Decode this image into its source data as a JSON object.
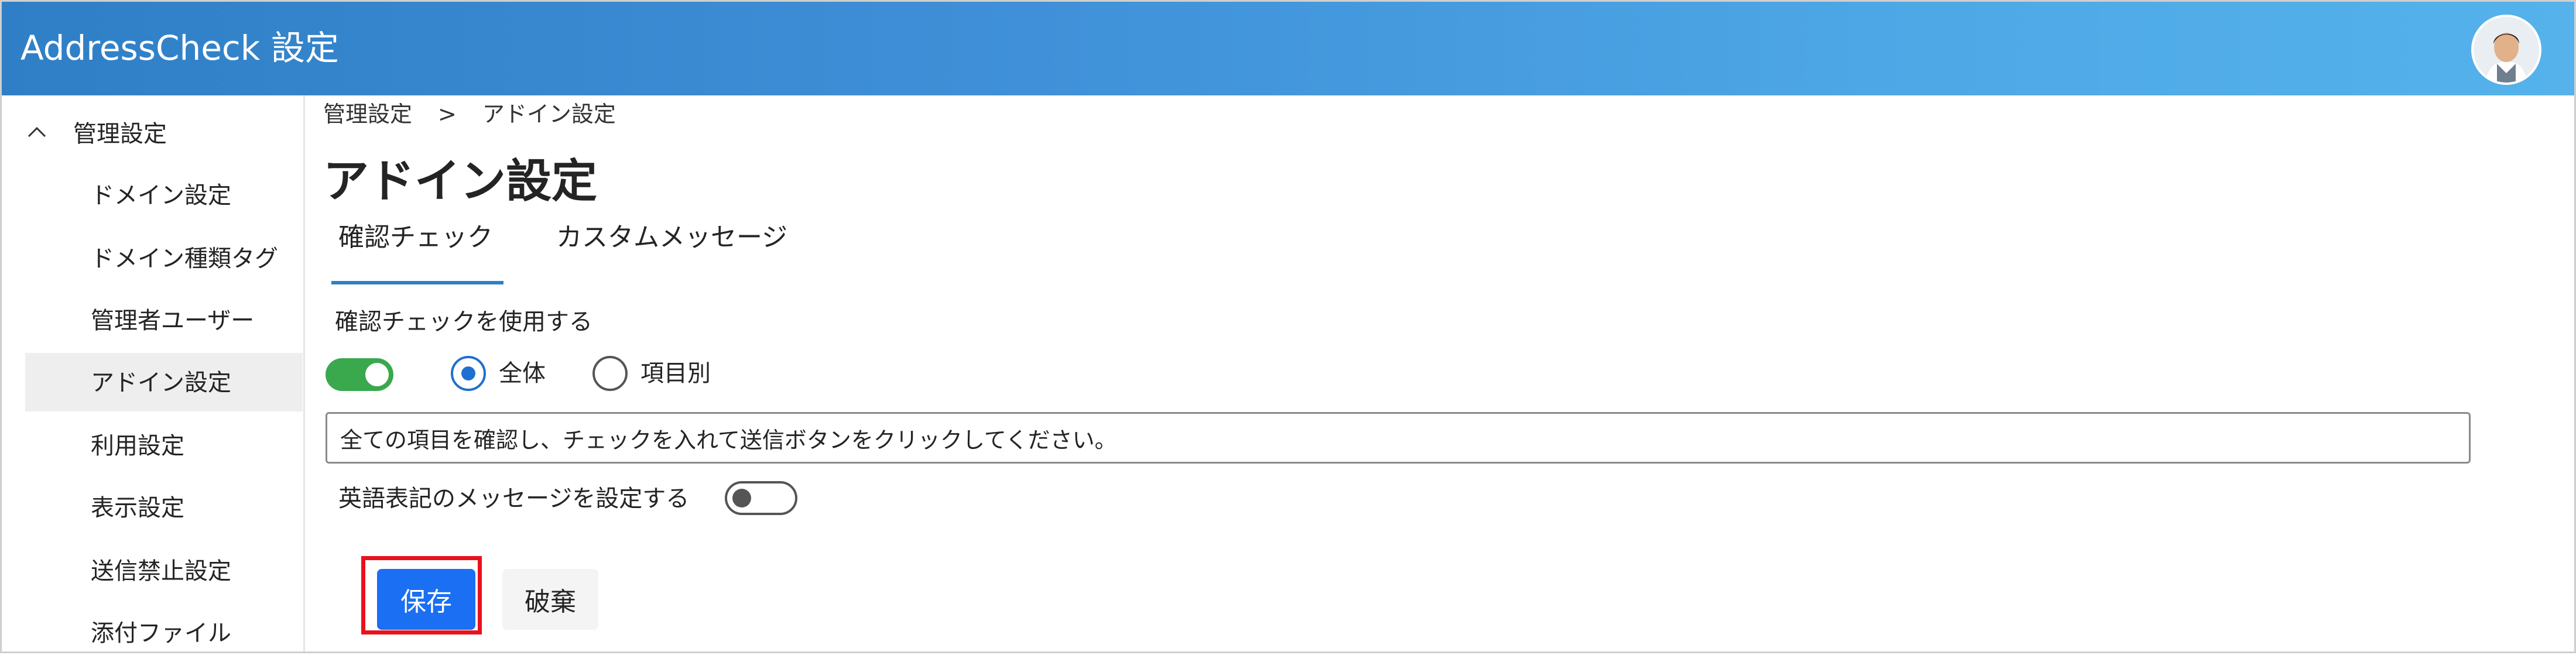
{
  "header": {
    "app_title": "AddressCheck 設定"
  },
  "sidebar": {
    "group_label": "管理設定",
    "items": [
      {
        "label": "ドメイン設定"
      },
      {
        "label": "ドメイン種類タグ"
      },
      {
        "label": "管理者ユーザー"
      },
      {
        "label": "アドイン設定"
      },
      {
        "label": "利用設定"
      },
      {
        "label": "表示設定"
      },
      {
        "label": "送信禁止設定"
      },
      {
        "label": "添付ファイル"
      }
    ],
    "active_index": 3
  },
  "breadcrumb": {
    "parent": "管理設定",
    "separator": ">",
    "current": "アドイン設定"
  },
  "page_title": "アドイン設定",
  "tabs": [
    {
      "label": "確認チェック",
      "selected": true
    },
    {
      "label": "カスタムメッセージ",
      "selected": false
    }
  ],
  "confirm_check": {
    "label": "確認チェックを使用する",
    "enabled": true,
    "scope_options": [
      {
        "label": "全体",
        "selected": true
      },
      {
        "label": "項目別",
        "selected": false
      }
    ],
    "message_value": "全ての項目を確認し、チェックを入れて送信ボタンをクリックしてください。",
    "english_label": "英語表記のメッセージを設定する",
    "english_enabled": false
  },
  "actions": {
    "save_label": "保存",
    "discard_label": "破棄"
  },
  "colors": {
    "header_start": "#2f7fc6",
    "header_end": "#55b2eb",
    "accent": "#1a6ff2",
    "toggle_on": "#3aa84d",
    "highlight": "#e8121c"
  }
}
